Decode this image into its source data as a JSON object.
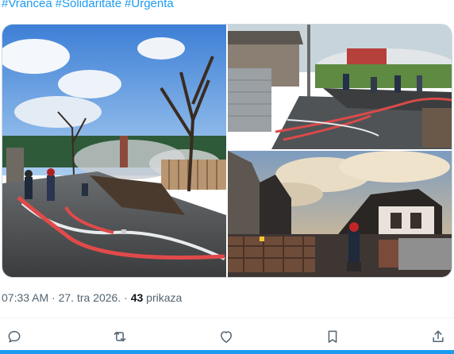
{
  "tweet": {
    "hashtags": [
      "#Vrancea",
      "#Solidaritate",
      "#Urgenta"
    ],
    "time": "07:33 AM",
    "separator": "·",
    "date": "27. tra 2026.",
    "views_count": "43",
    "views_label": "prikaza"
  },
  "media": {
    "photos": [
      {
        "name": "photo-street-fire-hoses"
      },
      {
        "name": "photo-firefighters-in-yard"
      },
      {
        "name": "photo-burned-house"
      }
    ]
  },
  "actions": [
    {
      "name": "reply-button",
      "icon": "speech-bubble-icon"
    },
    {
      "name": "repost-button",
      "icon": "repost-arrows-icon"
    },
    {
      "name": "like-button",
      "icon": "heart-icon"
    },
    {
      "name": "bookmark-button",
      "icon": "bookmark-icon"
    },
    {
      "name": "share-button",
      "icon": "share-upload-icon"
    }
  ],
  "colors": {
    "accent": "#1d9bf0",
    "text_secondary": "#536471",
    "text_primary": "#0f1419",
    "border": "#cfd9de"
  }
}
